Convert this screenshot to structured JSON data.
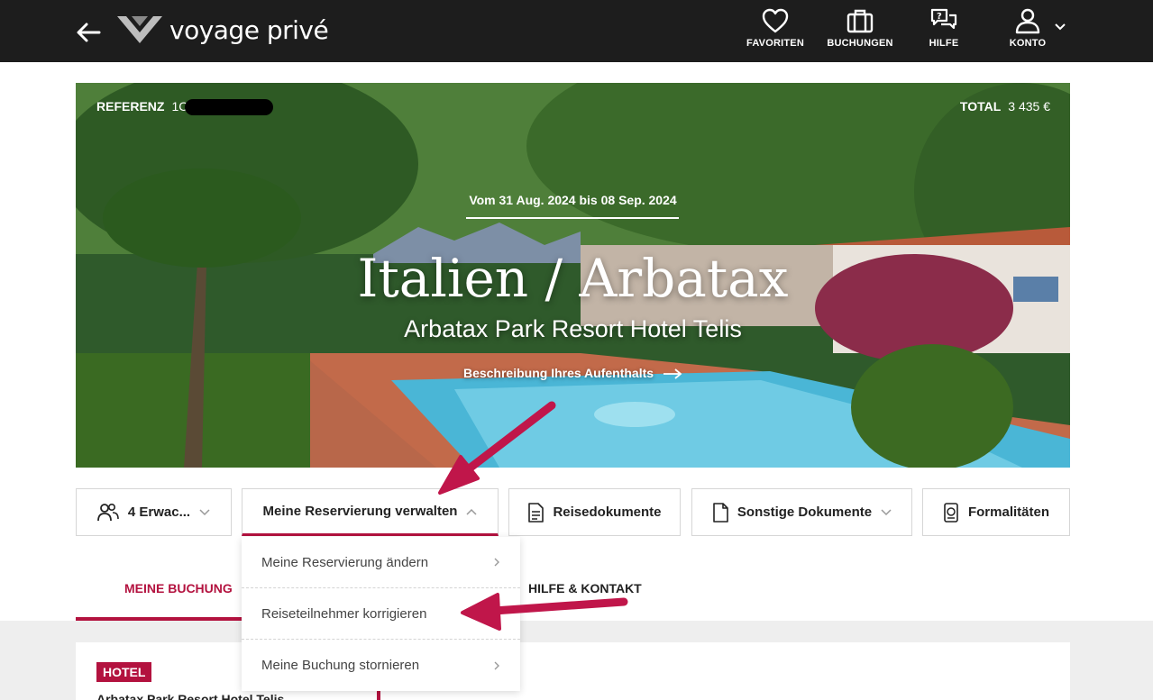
{
  "header": {
    "logo_text": "voyage privé",
    "nav": [
      {
        "label": "FAVORITEN",
        "icon": "heart-icon"
      },
      {
        "label": "BUCHUNGEN",
        "icon": "suitcase-icon"
      },
      {
        "label": "HILFE",
        "icon": "help-chat-icon"
      },
      {
        "label": "KONTO",
        "icon": "user-icon"
      }
    ]
  },
  "hero": {
    "ref_label": "REFERENZ",
    "ref_value": "1C",
    "total_label": "TOTAL",
    "total_value": "3 435 €",
    "dates": "Vom 31 Aug. 2024 bis 08 Sep. 2024",
    "destination": "Italien / Arbatax",
    "hotel": "Arbatax Park Resort Hotel Telis",
    "description_link": "Beschreibung Ihres Aufenthalts"
  },
  "actions": {
    "travellers": "4 Erwac...",
    "manage": "Meine Reservierung verwalten",
    "travel_docs": "Reisedokumente",
    "other_docs": "Sonstige Dokumente",
    "formalities": "Formalitäten"
  },
  "dropdown": {
    "items": [
      {
        "label": "Meine Reservierung ändern"
      },
      {
        "label": "Reiseteilnehmer korrigieren"
      },
      {
        "label": "Meine Buchung stornieren"
      }
    ]
  },
  "tabs": {
    "booking": "MEINE BUCHUNG",
    "help": "HILFE & KONTAKT"
  },
  "card": {
    "badge": "HOTEL",
    "title": "Arbatax Park Resort Hotel Telis"
  },
  "colors": {
    "accent": "#b3123f",
    "header_bg": "#1d1d1d",
    "annotation_arrow": "#c0164a"
  }
}
